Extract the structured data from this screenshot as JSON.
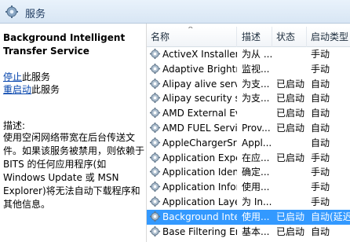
{
  "window": {
    "title": "服务"
  },
  "details": {
    "service_name": "Background Intelligent Transfer Service",
    "stop_link": "停止",
    "stop_suffix": "此服务",
    "restart_link": "重启动",
    "restart_suffix": "此服务",
    "description_label": "描述:",
    "description": "使用空闲网络带宽在后台传送文件。如果该服务被禁用，则依赖于 BITS 的任何应用程序(如 Windows Update 或 MSN Explorer)将无法自动下载程序和其他信息。"
  },
  "table": {
    "columns": [
      "名称",
      "描述",
      "状态",
      "启动类型"
    ],
    "sorted_column": "名称",
    "rows": [
      {
        "name": "ActiveX Installer ...",
        "desc": "为从 ...",
        "status": "",
        "startup": "手动"
      },
      {
        "name": "Adaptive Brightn...",
        "desc": "监视...",
        "status": "",
        "startup": "手动"
      },
      {
        "name": "Alipay alive servi...",
        "desc": "为支...",
        "status": "已启动",
        "startup": "自动"
      },
      {
        "name": "Alipay security s...",
        "desc": "为支...",
        "status": "已启动",
        "startup": "自动"
      },
      {
        "name": "AMD External Ev...",
        "desc": "",
        "status": "已启动",
        "startup": "自动"
      },
      {
        "name": "AMD FUEL Service",
        "desc": "Prov...",
        "status": "已启动",
        "startup": "自动"
      },
      {
        "name": "AppleChargerSrv",
        "desc": "Appl...",
        "status": "",
        "startup": "自动"
      },
      {
        "name": "Application Expe...",
        "desc": "在应...",
        "status": "已启动",
        "startup": "手动"
      },
      {
        "name": "Application Iden...",
        "desc": "确定...",
        "status": "",
        "startup": "手动"
      },
      {
        "name": "Application Infor...",
        "desc": "使用...",
        "status": "",
        "startup": "手动"
      },
      {
        "name": "Application Laye...",
        "desc": "为 In...",
        "status": "",
        "startup": "手动"
      },
      {
        "name": "Background Inte...",
        "desc": "使用...",
        "status": "已启动",
        "startup": "自动(延迟...",
        "selected": true
      },
      {
        "name": "Base Filtering En...",
        "desc": "基本...",
        "status": "已启动",
        "startup": "自动"
      }
    ]
  }
}
